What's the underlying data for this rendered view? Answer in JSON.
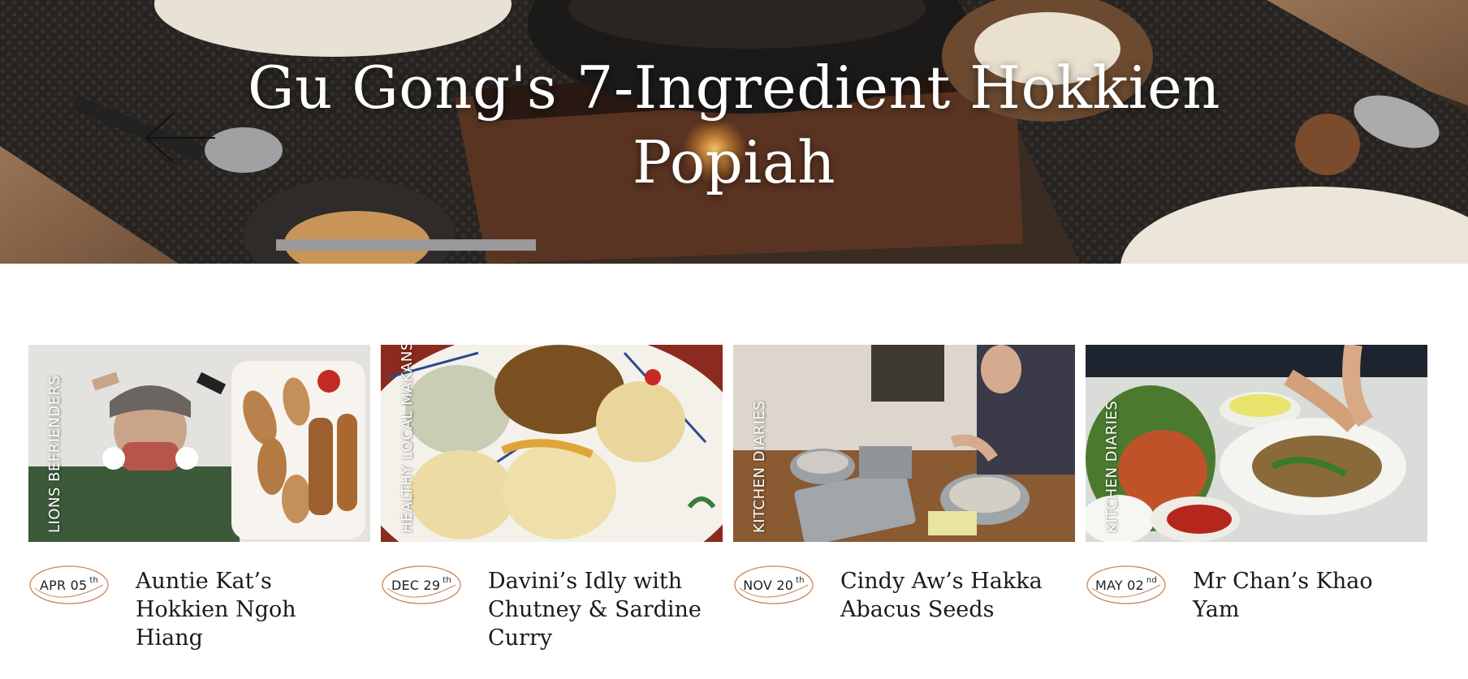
{
  "hero": {
    "title": "Gu Gong's 7-Ingredient Hokkien Popiah",
    "arrow_icon": "arrow-left-icon"
  },
  "colors": {
    "badge_ring": "#c8875a",
    "title_text": "#1a1a1a",
    "hero_text": "#ffffff"
  },
  "cards": [
    {
      "category": "LIONS BEFRIENDERS",
      "date": "APR 05",
      "suffix": "th",
      "title": "Auntie Kat’s Hokkien Ngoh Hiang"
    },
    {
      "category": "HEALTHY LOCAL MAKANS",
      "date": "DEC 29",
      "suffix": "th",
      "title": "Davini’s Idly with Chutney & Sardine Curry"
    },
    {
      "category": "KITCHEN DIARIES",
      "date": "NOV 20",
      "suffix": "th",
      "title": "Cindy Aw’s Hakka Abacus Seeds"
    },
    {
      "category": "KITCHEN DIARIES",
      "date": "MAY 02",
      "suffix": "nd",
      "title": "Mr Chan’s Khao Yam"
    }
  ]
}
